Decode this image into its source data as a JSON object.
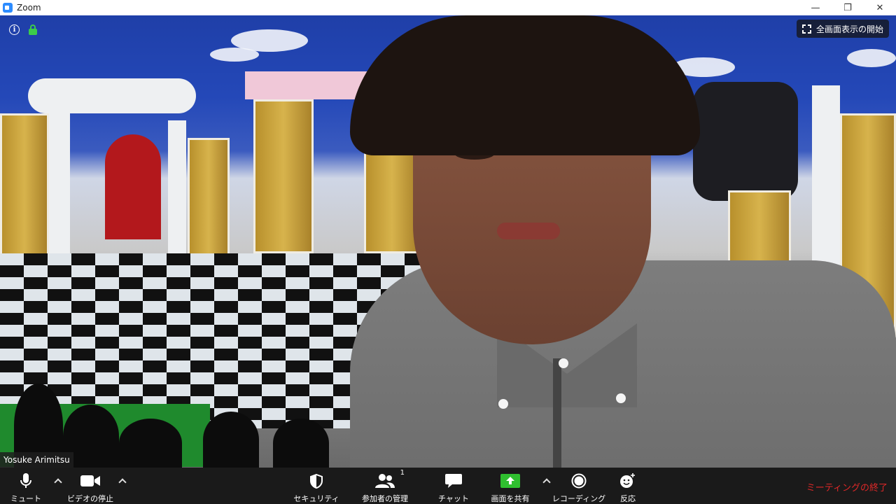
{
  "window": {
    "app_title": "Zoom",
    "minimize_glyph": "—",
    "restore_glyph": "❐",
    "close_glyph": "✕"
  },
  "video": {
    "info_glyph": "i",
    "fullscreen_label": "全画面表示の開始",
    "participant_name": "Yosuke Arimitsu"
  },
  "toolbar": {
    "mute_label": "ミュート",
    "video_label": "ビデオの停止",
    "security_label": "セキュリティ",
    "participants_label": "参加者の管理",
    "participants_count": "1",
    "chat_label": "チャット",
    "share_label": "画面を共有",
    "record_label": "レコーディング",
    "reactions_label": "反応",
    "end_label": "ミーティングの終了"
  },
  "colors": {
    "share_green": "#2fbf2f",
    "end_red": "#e02828",
    "lock_green": "#3ccc4a",
    "toolbar_bg": "#1a1a1a"
  },
  "icons": [
    "zoom-app-icon",
    "info-icon",
    "lock-icon",
    "fullscreen-icon",
    "microphone-icon",
    "camera-icon",
    "shield-icon",
    "people-icon",
    "chat-bubble-icon",
    "share-screen-icon",
    "record-icon",
    "emoji-add-icon",
    "chevron-up-icon"
  ]
}
